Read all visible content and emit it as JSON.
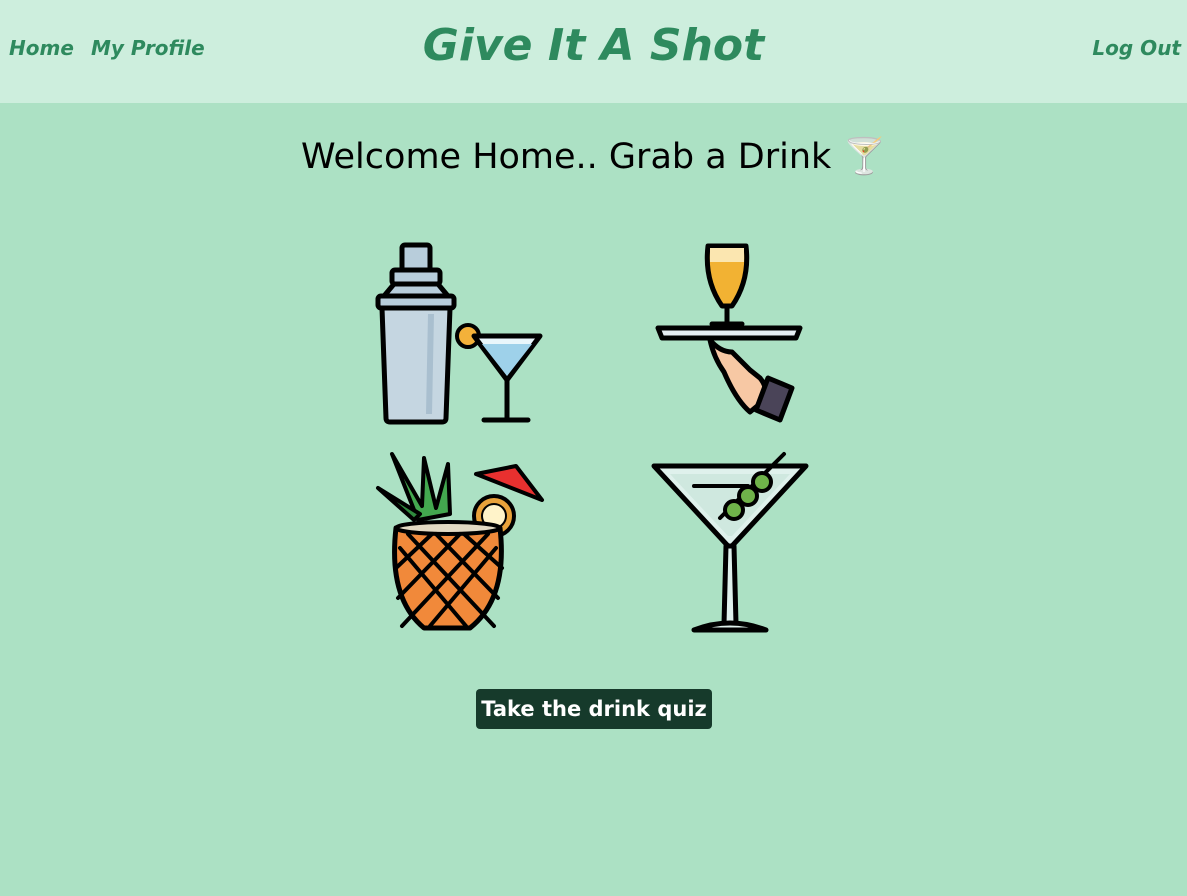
{
  "nav": {
    "home_label": "Home",
    "profile_label": "My Profile",
    "logout_label": "Log Out"
  },
  "header": {
    "title": "Give It A Shot"
  },
  "main": {
    "welcome_text": "Welcome Home.. Grab a Drink 🍸",
    "tiles": [
      {
        "icon": "cocktail-shaker-icon"
      },
      {
        "icon": "drink-tray-icon"
      },
      {
        "icon": "pineapple-cocktail-icon"
      },
      {
        "icon": "martini-olives-icon"
      }
    ],
    "quiz_button_label": "Take the drink quiz"
  },
  "colors": {
    "page_background": "#ace1c4",
    "header_background": "#cdeedd",
    "brand_green": "#2e8a5e",
    "button_background": "#163a2b",
    "button_text": "#ffffff"
  }
}
